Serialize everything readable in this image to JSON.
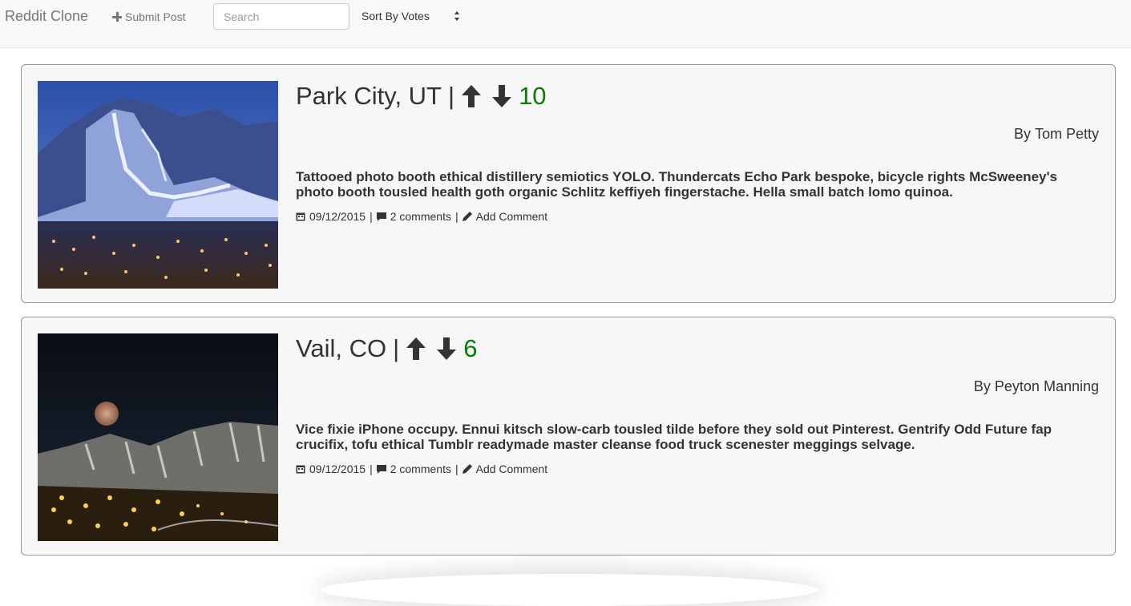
{
  "navbar": {
    "brand": "Reddit Clone",
    "submit_label": "Submit Post",
    "search_placeholder": "Search",
    "sort_label": "Sort By Votes"
  },
  "posts": [
    {
      "title": "Park City, UT",
      "separator": "|",
      "votes": "10",
      "author_prefix": "By",
      "author": "Tom Petty",
      "body": "Tattooed photo booth ethical distillery semiotics YOLO. Thundercats Echo Park bespoke, bicycle rights McSweeney's photo booth tousled health goth organic Schlitz keffiyeh fingerstache. Hella small batch lomo quinoa.",
      "date": "09/12/2015",
      "comments": "2 comments",
      "add_comment": "Add Comment"
    },
    {
      "title": "Vail, CO",
      "separator": "|",
      "votes": "6",
      "author_prefix": "By",
      "author": "Peyton Manning",
      "body": "Vice fixie iPhone occupy. Ennui kitsch slow-carb tousled tilde before they sold out Pinterest. Gentrify Odd Future fap crucifix, tofu ethical Tumblr readymade master cleanse food truck scenester meggings selvage.",
      "date": "09/12/2015",
      "comments": "2 comments",
      "add_comment": "Add Comment"
    }
  ],
  "colors": {
    "vote_count": "#0a7a0a",
    "navbar_bg": "#f8f8f8",
    "card_bg": "#f7f7f7"
  },
  "icons": [
    "plus-icon",
    "arrow-up-icon",
    "arrow-down-icon",
    "calendar-icon",
    "comment-icon",
    "pencil-icon",
    "sort-arrows-icon"
  ]
}
